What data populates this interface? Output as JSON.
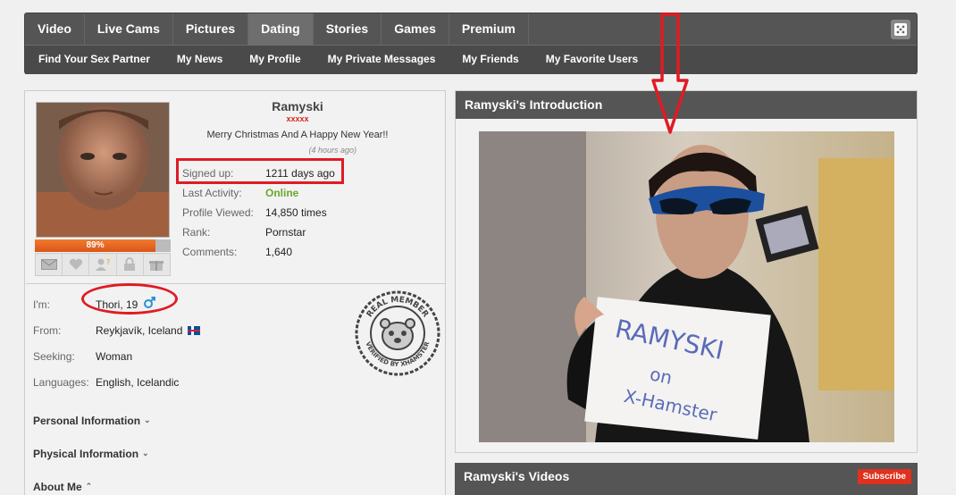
{
  "nav": {
    "main_tabs": [
      "Video",
      "Live Cams",
      "Pictures",
      "Dating",
      "Stories",
      "Games",
      "Premium"
    ],
    "active_tab": "Dating",
    "sub_tabs": [
      "Find Your Sex Partner",
      "My News",
      "My Profile",
      "My Private Messages",
      "My Friends",
      "My Favorite Users"
    ]
  },
  "profile": {
    "username": "Ramyski",
    "stars": "xxxxx",
    "status": "Merry Christmas And A Happy New Year!!",
    "status_time": "(4 hours ago)",
    "rating": "89%",
    "rating_fraction": 0.89,
    "stats": [
      {
        "label": "Signed up:",
        "value": "1211 days ago"
      },
      {
        "label": "Last Activity:",
        "value": "Online"
      },
      {
        "label": "Profile Viewed:",
        "value": "14,850 times"
      },
      {
        "label": "Rank:",
        "value": "Pornstar"
      },
      {
        "label": "Comments:",
        "value": "1,640"
      }
    ],
    "info": [
      {
        "label": "I'm:",
        "value": "Thori, 19"
      },
      {
        "label": "From:",
        "value": "Reykjavík, Iceland"
      },
      {
        "label": "Seeking:",
        "value": "Woman"
      },
      {
        "label": "Languages:",
        "value": "English, Icelandic"
      }
    ],
    "sections": [
      {
        "label": "Personal Information",
        "caret": "⌄"
      },
      {
        "label": "Physical Information",
        "caret": "⌄"
      },
      {
        "label": "About Me",
        "caret": "⌃"
      }
    ],
    "stamp": {
      "top": "REAL MEMBER",
      "bottom": "VERIFIED BY XHAMSTER"
    }
  },
  "intro": {
    "title": "Ramyski's Introduction",
    "sign_text": "RAMYSKI on X-Hamster"
  },
  "videos": {
    "title": "Ramyski's Videos",
    "subscribe": "Subscribe"
  },
  "colors": {
    "annotation": "#e01b24",
    "online": "#6aa82c",
    "header": "#555555"
  }
}
